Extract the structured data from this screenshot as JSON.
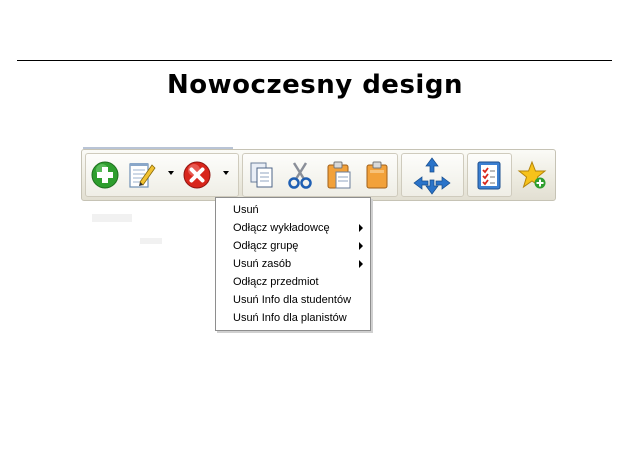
{
  "slide": {
    "title": "Nowoczesny design"
  },
  "toolbar": {
    "buttons": [
      {
        "icon": "add-icon"
      },
      {
        "icon": "edit-notepad-icon"
      },
      {
        "icon": "delete-icon"
      },
      {
        "icon": "copy-icon"
      },
      {
        "icon": "cut-scissors-icon"
      },
      {
        "icon": "paste-icon"
      },
      {
        "icon": "clipboard-icon"
      },
      {
        "icon": "move-arrows-icon"
      },
      {
        "icon": "checklist-icon"
      },
      {
        "icon": "star-add-icon"
      }
    ]
  },
  "delete_menu": {
    "items": [
      {
        "label": "Usuń",
        "has_submenu": false
      },
      {
        "label": "Odłącz wykładowcę",
        "has_submenu": true
      },
      {
        "label": "Odłącz grupę",
        "has_submenu": true
      },
      {
        "label": "Usuń zasób",
        "has_submenu": true
      },
      {
        "label": "Odłącz przedmiot",
        "has_submenu": false
      },
      {
        "label": "Usuń Info dla studentów",
        "has_submenu": false
      },
      {
        "label": "Usuń Info dla planistów",
        "has_submenu": false
      }
    ]
  },
  "colors": {
    "add_green": "#2e9e2e",
    "delete_red": "#d8261c",
    "paste_orange": "#f2a13a",
    "arrow_blue": "#2a73c9",
    "star_yellow": "#f7c21a"
  }
}
